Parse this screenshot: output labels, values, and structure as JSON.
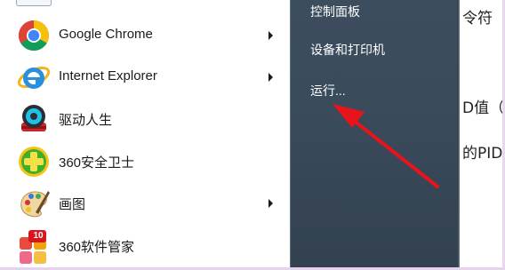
{
  "start_menu": {
    "programs": [
      {
        "label": "Google Chrome",
        "icon": "chrome-icon",
        "has_submenu": true
      },
      {
        "label": "Internet Explorer",
        "icon": "internet-explorer-icon",
        "has_submenu": true
      },
      {
        "label": "驱动人生",
        "icon": "driver-life-icon",
        "has_submenu": false
      },
      {
        "label": "360安全卫士",
        "icon": "360-safe-icon",
        "has_submenu": false
      },
      {
        "label": "画图",
        "icon": "paint-icon",
        "has_submenu": true
      },
      {
        "label": "360软件管家",
        "icon": "360-software-manager-icon",
        "has_submenu": false,
        "badge": "10"
      }
    ],
    "right_items": [
      {
        "label": "控制面板"
      },
      {
        "label": "设备和打印机"
      },
      {
        "label": "运行..."
      }
    ]
  },
  "background_doc": {
    "line1": "令符",
    "line2": "D值（",
    "line3": "的PID"
  },
  "annotation": {
    "arrow_color": "#e8141b"
  }
}
